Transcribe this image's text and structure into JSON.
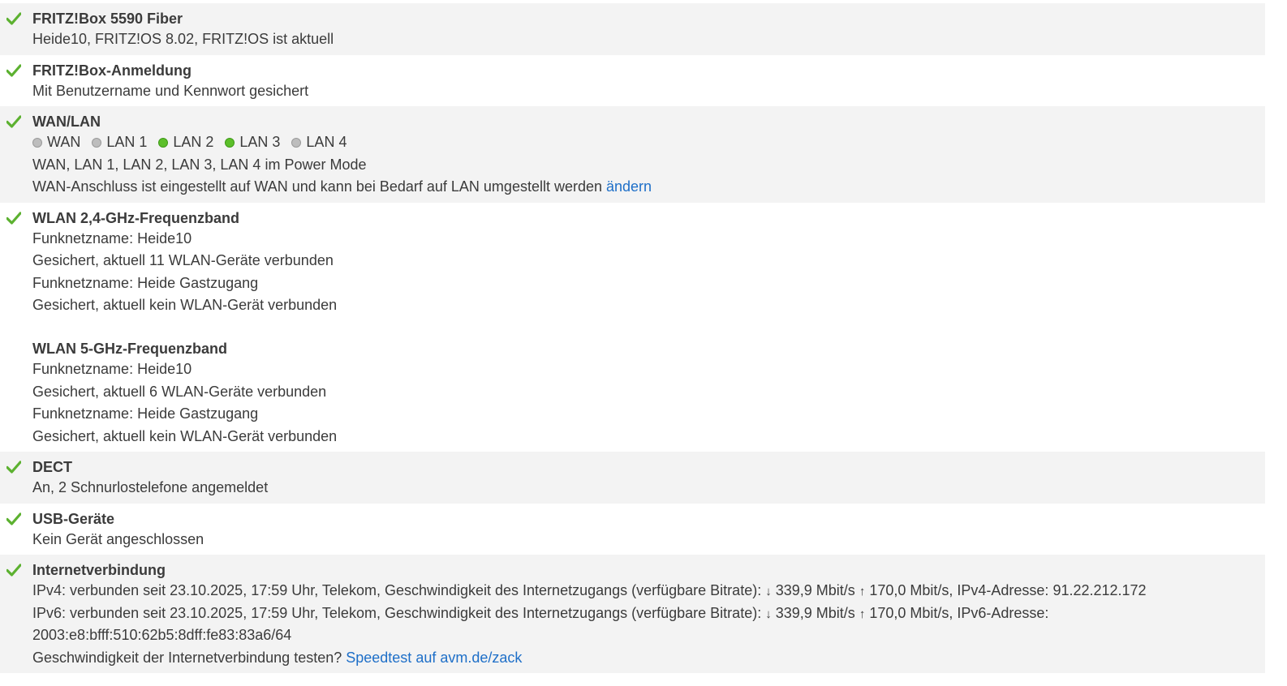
{
  "accent": "#5cb130",
  "link_color": "#1e6fc8",
  "items": [
    {
      "title": "FRITZ!Box 5590 Fiber",
      "lines": [
        "Heide10, FRITZ!OS 8.02, FRITZ!OS ist aktuell"
      ]
    },
    {
      "title": "FRITZ!Box-Anmeldung",
      "lines": [
        "Mit Benutzername und Kennwort gesichert"
      ]
    },
    {
      "title": "WAN/LAN",
      "leds": [
        {
          "label": "WAN",
          "state": "off"
        },
        {
          "label": "LAN 1",
          "state": "off"
        },
        {
          "label": "LAN 2",
          "state": "on"
        },
        {
          "label": "LAN 3",
          "state": "on"
        },
        {
          "label": "LAN 4",
          "state": "off"
        }
      ],
      "power_mode": "WAN, LAN 1, LAN 2, LAN 3, LAN 4 im Power Mode",
      "wan_text": "WAN-Anschluss ist eingestellt auf WAN und kann bei Bedarf auf LAN umgestellt werden",
      "wan_link": "ändern"
    },
    {
      "title": "WLAN 2,4-GHz-Frequenzband",
      "lines": [
        "Funknetzname: Heide10",
        "Gesichert, aktuell 11 WLAN-Geräte verbunden",
        "Funknetzname: Heide Gastzugang",
        "Gesichert, aktuell kein WLAN-Gerät verbunden"
      ],
      "sub_title": "WLAN 5-GHz-Frequenzband",
      "sub_lines": [
        "Funknetzname: Heide10",
        "Gesichert, aktuell 6 WLAN-Geräte verbunden",
        "Funknetzname: Heide Gastzugang",
        "Gesichert, aktuell kein WLAN-Gerät verbunden"
      ]
    },
    {
      "title": "DECT",
      "lines": [
        "An, 2 Schnurlostelefone angemeldet"
      ]
    },
    {
      "title": "USB-Geräte",
      "lines": [
        "Kein Gerät angeschlossen"
      ]
    },
    {
      "title": "Internetverbindung",
      "ipv4": {
        "prefix": "IPv4: verbunden seit 23.10.2025, 17:59 Uhr, Telekom, Geschwindigkeit des Internetzugangs (verfügbare Bitrate):",
        "down": "339,9 Mbit/s",
        "up": "170,0 Mbit/s",
        "suffix": ", IPv4-Adresse: 91.22.212.172"
      },
      "ipv6": {
        "prefix": "IPv6: verbunden seit 23.10.2025, 17:59 Uhr, Telekom, Geschwindigkeit des Internetzugangs (verfügbare Bitrate):",
        "down": "339,9 Mbit/s",
        "up": "170,0 Mbit/s",
        "suffix": ", IPv6-Adresse:",
        "address": "2003:e8:bfff:510:62b5:8dff:fe83:83a6/64"
      },
      "speedtest_text": "Geschwindigkeit der Internetverbindung testen?",
      "speedtest_link": "Speedtest auf avm.de/zack"
    }
  ]
}
